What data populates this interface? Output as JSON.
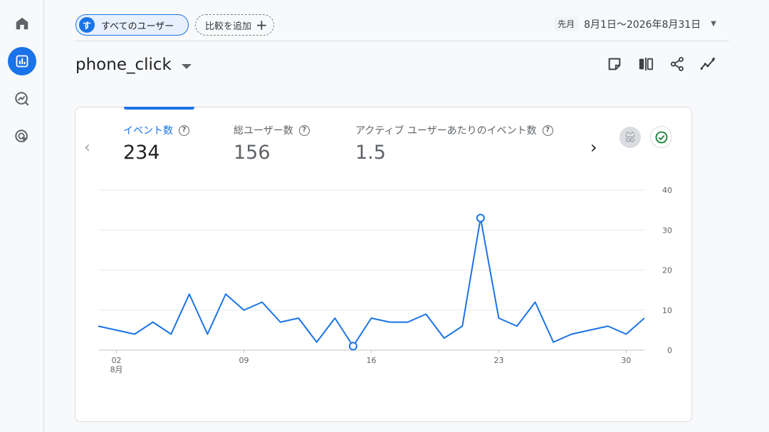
{
  "sidebar": {
    "items": [
      {
        "name": "home-icon",
        "active": false
      },
      {
        "name": "reports-icon",
        "active": true
      },
      {
        "name": "explore-icon",
        "active": false
      },
      {
        "name": "advertising-icon",
        "active": false
      }
    ]
  },
  "topbar": {
    "segment_avatar": "す",
    "segment_label": "すべてのユーザー",
    "compare_label": "比較を追加",
    "date_prefix": "先月",
    "date_range": "8月1日～2026年8月31日"
  },
  "header": {
    "title": "phone_click"
  },
  "metrics": [
    {
      "label": "イベント数",
      "value": "234",
      "active": true
    },
    {
      "label": "総ユーザー数",
      "value": "156",
      "active": false
    },
    {
      "label": "アクティブ ユーザーあたりのイベント数",
      "value": "1.5",
      "active": false
    }
  ],
  "colors": {
    "accent": "#1a73e8",
    "success": "#188038"
  },
  "chart_data": {
    "type": "line",
    "title": "",
    "xlabel": "",
    "ylabel": "",
    "x": [
      1,
      2,
      3,
      4,
      5,
      6,
      7,
      8,
      9,
      10,
      11,
      12,
      13,
      14,
      15,
      16,
      17,
      18,
      19,
      20,
      21,
      22,
      23,
      24,
      25,
      26,
      27,
      28,
      29,
      30,
      31
    ],
    "series": [
      {
        "name": "",
        "values": [
          6,
          5,
          4,
          7,
          4,
          14,
          4,
          14,
          10,
          12,
          7,
          8,
          2,
          8,
          1,
          8,
          7,
          7,
          9,
          3,
          6,
          33,
          8,
          6,
          12,
          2,
          4,
          5,
          6,
          4,
          8
        ]
      }
    ],
    "ylim": [
      0,
      40
    ],
    "yticks": [
      "0",
      "10",
      "20",
      "30",
      "40"
    ],
    "xticks": [
      {
        "day": 2,
        "label": "02",
        "sub": "8月"
      },
      {
        "day": 9,
        "label": "09",
        "sub": ""
      },
      {
        "day": 16,
        "label": "16",
        "sub": ""
      },
      {
        "day": 23,
        "label": "23",
        "sub": ""
      },
      {
        "day": 30,
        "label": "30",
        "sub": ""
      }
    ],
    "highlighted_points": [
      15,
      22
    ],
    "y_axis_side": "right",
    "grid": true
  }
}
